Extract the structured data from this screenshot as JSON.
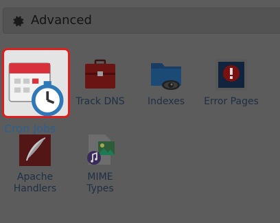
{
  "section": {
    "title": "Advanced",
    "icon": "gear-icon"
  },
  "tools": [
    {
      "label": "Cron Jobs",
      "icon": "calendar-clock-icon",
      "highlighted": true
    },
    {
      "label": "Track DNS",
      "icon": "toolbox-icon"
    },
    {
      "label": "Indexes",
      "icon": "folder-eye-icon"
    },
    {
      "label": "Error Pages",
      "icon": "alert-icon"
    },
    {
      "label": "Apache Handlers",
      "icon": "feather-icon"
    },
    {
      "label": "MIME Types",
      "icon": "media-file-icon"
    }
  ],
  "colors": {
    "overlay": "#5c5c5c",
    "highlight_border": "#e01d1d",
    "label": "#1e2f44"
  }
}
